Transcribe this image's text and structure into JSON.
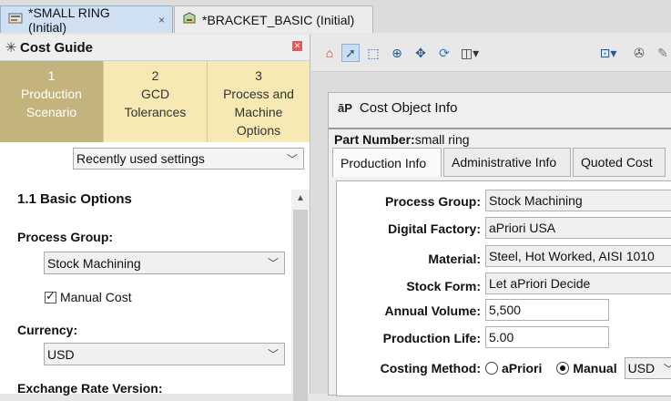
{
  "doc_tabs": [
    {
      "label": "*SMALL RING (Initial)",
      "close": "×"
    },
    {
      "label": "*BRACKET_BASIC (Initial)"
    }
  ],
  "cost_guide": {
    "title": "Cost Guide",
    "steps": [
      {
        "number": "1",
        "line1": "Production",
        "line2": "Scenario",
        "line3": ""
      },
      {
        "number": "2",
        "line1": "GCD",
        "line2": "Tolerances",
        "line3": ""
      },
      {
        "number": "3",
        "line1": "Process and",
        "line2": "Machine",
        "line3": "Options"
      }
    ],
    "recent_settings": "Recently used settings",
    "section_title": "1.1 Basic Options",
    "process_group_label": "Process Group:",
    "process_group_value": "Stock Machining",
    "manual_cost_label": "Manual Cost",
    "manual_cost_checked": true,
    "currency_label": "Currency:",
    "currency_value": "USD",
    "exchange_rate_label": "Exchange Rate Version:"
  },
  "cost_object": {
    "logo_text": "āP",
    "title": "Cost Object Info",
    "part_number_label": "Part Number:",
    "part_number_value": "small ring",
    "tabs": [
      "Production Info",
      "Administrative Info",
      "Quoted Cost"
    ],
    "fields": [
      {
        "label": "Process Group:",
        "value": "Stock Machining",
        "kind": "readonly"
      },
      {
        "label": "Digital Factory:",
        "value": "aPriori USA",
        "kind": "readonly"
      },
      {
        "label": "Material:",
        "value": "Steel, Hot Worked, AISI 1010",
        "kind": "readonly"
      },
      {
        "label": "Stock Form:",
        "value": "Let aPriori Decide",
        "kind": "readonly"
      },
      {
        "label": "Annual Volume:",
        "value": "5,500",
        "kind": "input"
      },
      {
        "label": "Production Life:",
        "value": "5.00",
        "kind": "input"
      }
    ],
    "costing_method_label": "Costing Method:",
    "costing_options": [
      "aPriori",
      "Manual"
    ],
    "costing_selected": "Manual",
    "costing_currency": "USD"
  }
}
